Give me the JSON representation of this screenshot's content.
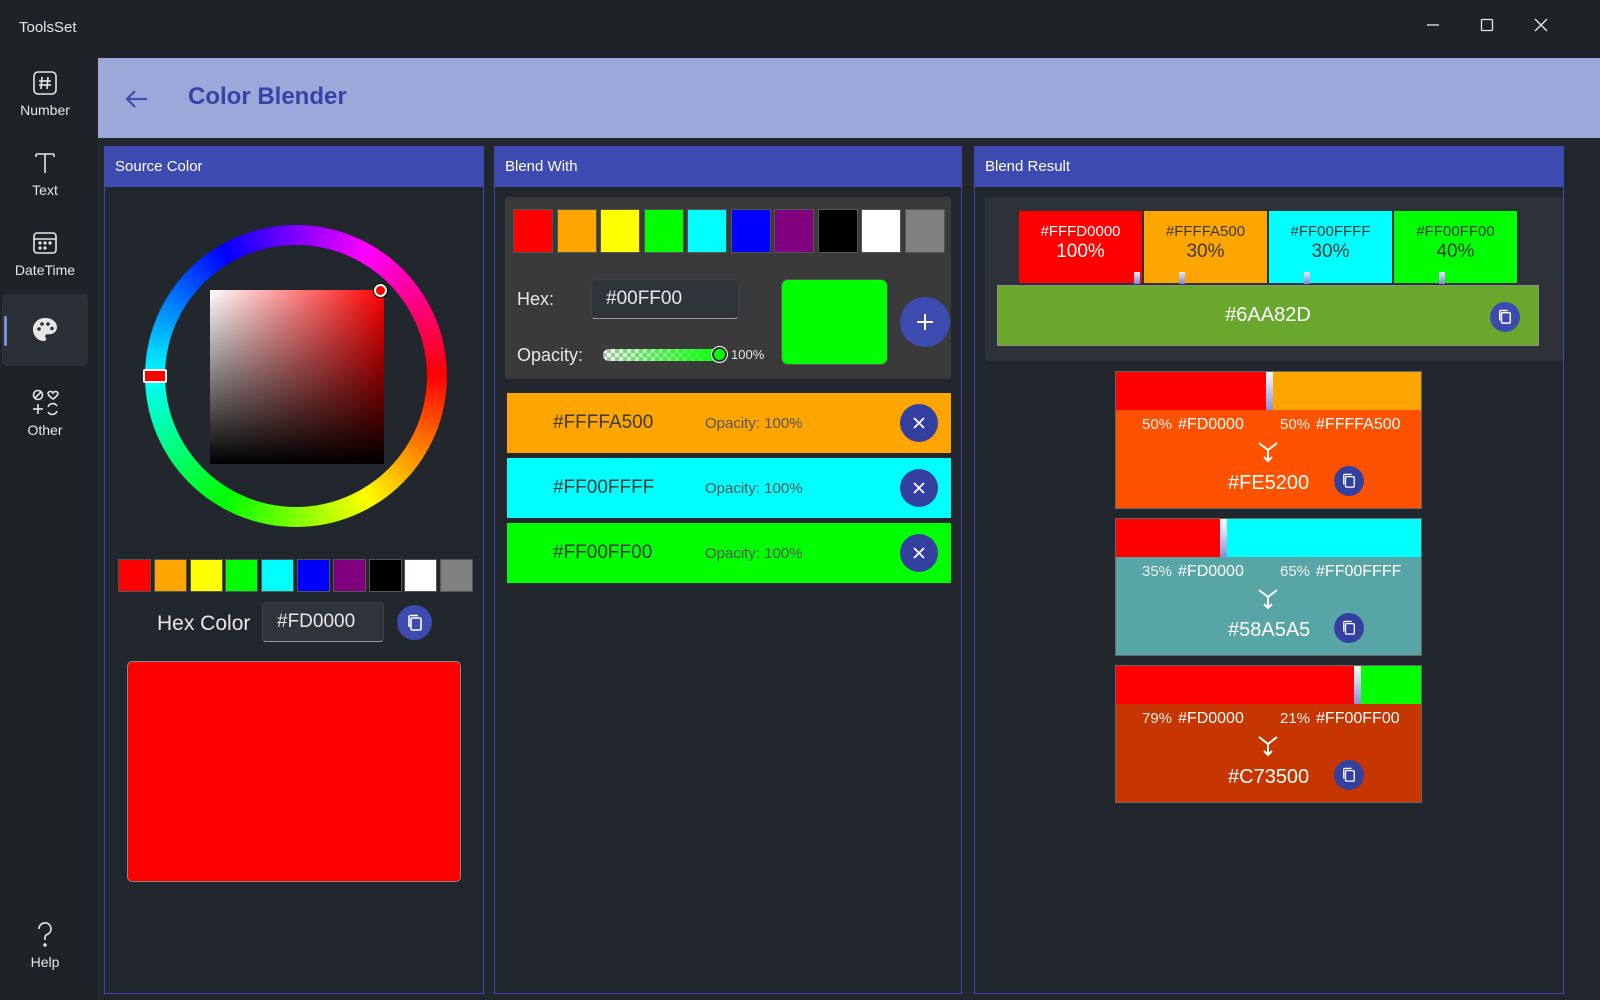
{
  "app": {
    "title": "ToolsSet"
  },
  "nav": {
    "items": [
      {
        "label": "Number",
        "icon": "hash-icon"
      },
      {
        "label": "Text",
        "icon": "text-icon"
      },
      {
        "label": "DateTime",
        "icon": "calendar-icon"
      },
      {
        "label": "",
        "icon": "palette-icon",
        "active": true
      },
      {
        "label": "Other",
        "icon": "shapes-icon"
      }
    ],
    "help_label": "Help"
  },
  "header": {
    "title": "Color Blender"
  },
  "source": {
    "title": "Source Color",
    "swatches": [
      "#ff0000",
      "#ffa500",
      "#ffff00",
      "#00ff00",
      "#00ffff",
      "#0000ff",
      "#800080",
      "#000000",
      "#ffffff",
      "#808080"
    ],
    "hex_label": "Hex Color",
    "hex_value": "#FD0000",
    "preview_color": "#ff0000"
  },
  "blend_with": {
    "title": "Blend With",
    "swatches": [
      "#ff0000",
      "#ffa500",
      "#ffff00",
      "#00ff00",
      "#00ffff",
      "#0000ff",
      "#800080",
      "#000000",
      "#ffffff",
      "#808080"
    ],
    "hex_label": "Hex:",
    "hex_value": "#00FF00",
    "opacity_label": "Opacity:",
    "opacity_value": "100%",
    "opacity_fraction": 1.0,
    "preview_color": "#00ff00",
    "items": [
      {
        "hex": "#FFFFA500",
        "opacity": "Opacity: 100%",
        "color": "#ffa500"
      },
      {
        "hex": "#FF00FFFF",
        "opacity": "Opacity: 100%",
        "color": "#00ffff"
      },
      {
        "hex": "#FF00FF00",
        "opacity": "Opacity: 100%",
        "color": "#00ff00"
      }
    ]
  },
  "blend_result": {
    "title": "Blend Result",
    "chips": [
      {
        "hex": "#FFFD0000",
        "pct": "100%",
        "color": "#ff0000",
        "text_color": "#ffffff"
      },
      {
        "hex": "#FFFFA500",
        "pct": "30%",
        "color": "#ffa500",
        "text_color": "#3a3a3a"
      },
      {
        "hex": "#FF00FFFF",
        "pct": "30%",
        "color": "#00ffff",
        "text_color": "#3a3a3a"
      },
      {
        "hex": "#FF00FF00",
        "pct": "40%",
        "color": "#00ff00",
        "text_color": "#3a3a3a"
      }
    ],
    "result_hex": "#6AA82D",
    "result_color": "#6aa82d",
    "mixes": [
      {
        "left_pct": "50%",
        "left_hex": "#FD0000",
        "right_pct": "50%",
        "right_hex": "#FFFFA500",
        "left_color": "#ff0000",
        "right_color": "#ffa500",
        "split": 0.5,
        "result": "#FE5200",
        "result_color": "#fe5200"
      },
      {
        "left_pct": "35%",
        "left_hex": "#FD0000",
        "right_pct": "65%",
        "right_hex": "#FF00FFFF",
        "left_color": "#ff0000",
        "right_color": "#00ffff",
        "split": 0.35,
        "result": "#58A5A5",
        "result_color": "#58a5a5"
      },
      {
        "left_pct": "79%",
        "left_hex": "#FD0000",
        "right_pct": "21%",
        "right_hex": "#FF00FF00",
        "left_color": "#ff0000",
        "right_color": "#00ff00",
        "split": 0.79,
        "result": "#C73500",
        "result_color": "#c73500"
      }
    ]
  }
}
